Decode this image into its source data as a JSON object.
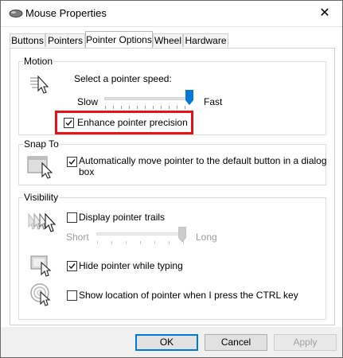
{
  "window": {
    "title": "Mouse Properties",
    "close_glyph": "✕"
  },
  "tabs": [
    {
      "label": "Buttons"
    },
    {
      "label": "Pointers"
    },
    {
      "label": "Pointer Options",
      "active": true
    },
    {
      "label": "Wheel"
    },
    {
      "label": "Hardware"
    }
  ],
  "motion": {
    "group_label": "Motion",
    "speed_label": "Select a pointer speed:",
    "slow_label": "Slow",
    "fast_label": "Fast",
    "speed_level": 1.0,
    "enhance_label": "Enhance pointer precision",
    "enhance_checked": true
  },
  "snap": {
    "group_label": "Snap To",
    "auto_label_line1": "Automatically move pointer to the default button in a dialog",
    "auto_label_line2": "box",
    "auto_checked": true
  },
  "visibility": {
    "group_label": "Visibility",
    "trails_label": "Display pointer trails",
    "trails_checked": false,
    "short_label": "Short",
    "long_label": "Long",
    "trail_level": 1.0,
    "hide_label": "Hide pointer while typing",
    "hide_checked": true,
    "ctrl_label": "Show location of pointer when I press the CTRL key",
    "ctrl_checked": false
  },
  "buttons": {
    "ok": "OK",
    "cancel": "Cancel",
    "apply": "Apply"
  },
  "colors": {
    "accent": "#0078d7",
    "highlight": "#e8111a"
  }
}
